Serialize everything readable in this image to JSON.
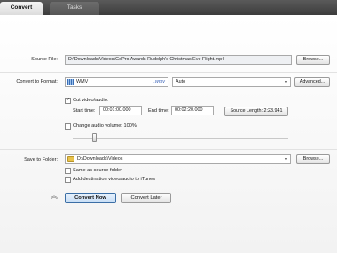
{
  "tabs": [
    {
      "label": "Convert",
      "active": true
    },
    {
      "label": "Tasks",
      "active": false
    }
  ],
  "source": {
    "label": "Source File:",
    "path": "D:\\Downloads\\Videos\\GoPro Awards  Rudolph's Christmas Eve Flight.mp4",
    "browse_label": "Browse..."
  },
  "format": {
    "label": "Convert to Format:",
    "name": "WMV",
    "ext": ".wmv",
    "preset": "Auto",
    "advanced_label": "Advanced..."
  },
  "cut": {
    "label": "Cut video/audio:",
    "checked": true,
    "start_label": "Start time:",
    "start_value": "00:01:00.000",
    "end_label": "End time:",
    "end_value": "00:02:20.000",
    "source_length_label": "Source Length: 2:23.941"
  },
  "volume": {
    "label": "Change audio volume: 100%",
    "checked": false,
    "level_percent": 100
  },
  "save": {
    "label": "Save to Folder:",
    "path": "D:\\Downloads\\Videos",
    "browse_label": "Browse...",
    "same_as_source_label": "Same as source folder",
    "same_as_source_checked": false,
    "add_itunes_label": "Add destination video/audio to iTunes",
    "add_itunes_checked": false
  },
  "actions": {
    "convert_now": "Convert Now",
    "convert_later": "Convert Later"
  },
  "colors": {
    "tabbar": "#4a4a4a",
    "convert_now_border": "#3b6ea5"
  }
}
